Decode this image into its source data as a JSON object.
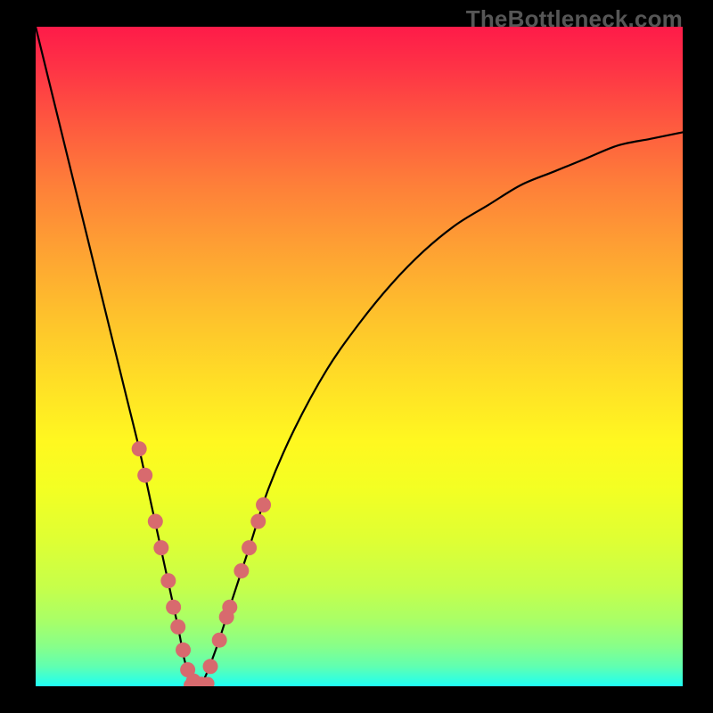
{
  "watermark": "TheBottleneck.com",
  "colors": {
    "frame_bg": "#000000",
    "curve_stroke": "#000000",
    "dot_fill": "#d86a6e",
    "gradient_top": "#fe1b49",
    "gradient_bottom": "#20fff5"
  },
  "chart_data": {
    "type": "line",
    "title": "",
    "xlabel": "",
    "ylabel": "",
    "xlim": [
      0,
      100
    ],
    "ylim": [
      0,
      100
    ],
    "grid": false,
    "series": [
      {
        "name": "bottleneck-curve",
        "x": [
          0,
          2,
          4,
          6,
          8,
          10,
          12,
          14,
          16,
          18,
          20,
          22,
          23,
          24,
          25,
          26,
          28,
          30,
          33,
          36,
          40,
          45,
          50,
          55,
          60,
          65,
          70,
          75,
          80,
          85,
          90,
          95,
          100
        ],
        "y": [
          100,
          92,
          84,
          76,
          68,
          60,
          52,
          44,
          36,
          27,
          18,
          9,
          4,
          1,
          0,
          1,
          6,
          12,
          21,
          30,
          39,
          48,
          55,
          61,
          66,
          70,
          73,
          76,
          78,
          80,
          82,
          83,
          84
        ]
      }
    ],
    "left_branch_dots": {
      "x": [
        16.0,
        16.9,
        18.5,
        19.4,
        20.5,
        21.3,
        22.0,
        22.8,
        23.5,
        24.4,
        25.6
      ],
      "y": [
        36,
        32,
        25,
        21,
        16,
        12,
        9,
        5.5,
        2.5,
        0.8,
        0.3
      ]
    },
    "right_branch_dots": {
      "x": [
        27.0,
        28.4,
        29.5,
        30.0,
        31.8,
        33.0,
        34.4,
        35.2
      ],
      "y": [
        3.0,
        7.0,
        10.5,
        12.0,
        17.5,
        21.0,
        25.0,
        27.5
      ]
    },
    "bottom_dots": {
      "x": [
        23.9,
        24.6,
        25.2,
        25.9,
        26.6
      ],
      "y": [
        0.15,
        0.05,
        0.0,
        0.1,
        0.4
      ]
    }
  }
}
